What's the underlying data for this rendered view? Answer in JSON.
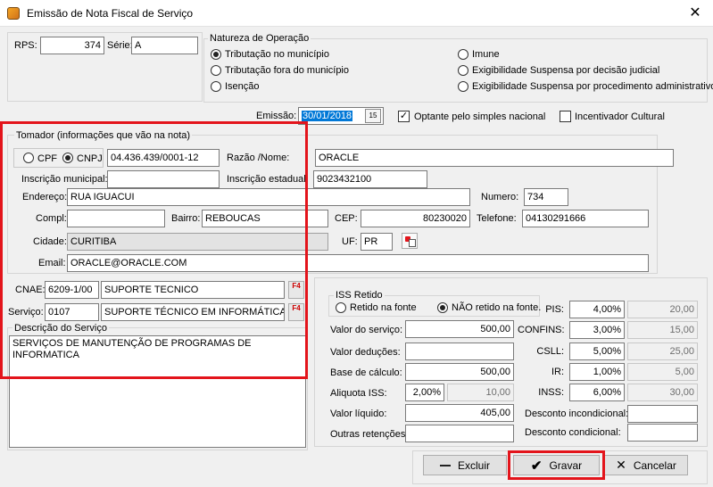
{
  "window": {
    "title": "Emissão de Nota Fiscal de Serviço",
    "close_glyph": "✕"
  },
  "rps": {
    "label": "RPS:",
    "value": "374",
    "serie_label": "Série:",
    "serie_value": "A"
  },
  "natureza": {
    "title": "Natureza de Operação",
    "options": [
      {
        "label": "Tributação no município",
        "selected": true
      },
      {
        "label": "Tributação fora do município",
        "selected": false
      },
      {
        "label": "Isenção",
        "selected": false
      },
      {
        "label": "Imune",
        "selected": false
      },
      {
        "label": "Exigibilidade Suspensa por decisão judicial",
        "selected": false
      },
      {
        "label": "Exigibilidade Suspensa por procedimento administrativo",
        "selected": false
      }
    ]
  },
  "emissao": {
    "label": "Emissão:",
    "value": "30/01/2018",
    "calendar_glyph": "15",
    "optante_label": "Optante pelo simples nacional",
    "optante_checked": true,
    "incentivador_label": "Incentivador Cultural",
    "incentivador_checked": false
  },
  "tomador": {
    "title": "Tomador (informações que vão na nota)",
    "cpf_label": "CPF",
    "cnpj_label": "CNPJ",
    "doc_value": "04.436.439/0001-12",
    "razao_label": "Razão /Nome:",
    "razao_value": "ORACLE",
    "insc_mun_label": "Inscrição municipal:",
    "insc_mun_value": "",
    "insc_est_label": "Inscrição estadual:",
    "insc_est_value": "9023432100",
    "endereco_label": "Endereço:",
    "endereco_value": "RUA IGUACUI",
    "numero_label": "Numero:",
    "numero_value": "734",
    "compl_label": "Compl:",
    "compl_value": "",
    "bairro_label": "Bairro:",
    "bairro_value": "REBOUCAS",
    "cep_label": "CEP:",
    "cep_value": "80230020",
    "telefone_label": "Telefone:",
    "telefone_value": "04130291666",
    "cidade_label": "Cidade:",
    "cidade_value": "CURITIBA",
    "uf_label": "UF:",
    "uf_value": "PR",
    "email_label": "Email:",
    "email_value": "ORACLE@ORACLE.COM"
  },
  "cnae": {
    "label": "CNAE:",
    "code": "6209-1/00",
    "desc": "SUPORTE TECNICO",
    "f4": "F4"
  },
  "servico": {
    "label": "Serviço:",
    "code": "0107",
    "desc": "SUPORTE TÉCNICO EM INFORMÁTICA,",
    "f4": "F4"
  },
  "descricao": {
    "title": "Descrição do Serviço",
    "text": "SERVIÇOS DE MANUTENÇÃO DE PROGRAMAS DE INFORMATICA"
  },
  "iss": {
    "title": "ISS Retido",
    "opt1": "Retido na fonte",
    "opt2": "NÃO retido na fonte."
  },
  "valores": {
    "valor_servico_label": "Valor do serviço:",
    "valor_servico": "500,00",
    "deducoes_label": "Valor deduções:",
    "deducoes": "",
    "base_label": "Base de cálculo:",
    "base": "500,00",
    "aliquota_label": "Aliquota ISS:",
    "aliquota": "2,00%",
    "aliquota_valor": "10,00",
    "liquido_label": "Valor líquido:",
    "liquido": "405,00",
    "outras_label": "Outras retenções:",
    "outras": ""
  },
  "impostos": [
    {
      "label": "PIS:",
      "pct": "4,00%",
      "valor": "20,00"
    },
    {
      "label": "CONFINS:",
      "pct": "3,00%",
      "valor": "15,00"
    },
    {
      "label": "CSLL:",
      "pct": "5,00%",
      "valor": "25,00"
    },
    {
      "label": "IR:",
      "pct": "1,00%",
      "valor": "5,00"
    },
    {
      "label": "INSS:",
      "pct": "6,00%",
      "valor": "30,00"
    }
  ],
  "descontos": {
    "incond_label": "Desconto incondicional:",
    "incond": "",
    "cond_label": "Desconto condicional:",
    "cond": ""
  },
  "buttons": {
    "excluir": "Excluir",
    "gravar": "Gravar",
    "cancelar": "Cancelar"
  },
  "colors": {
    "highlight": "#e3141b",
    "selection": "#0078d7"
  }
}
